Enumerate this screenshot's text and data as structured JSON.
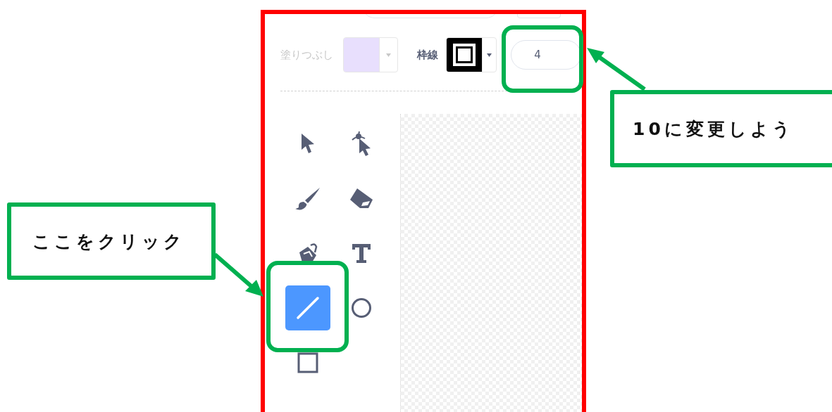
{
  "toolbar": {
    "fill": {
      "label": "塗りつぶし",
      "color": "#e0d4fc",
      "disabled": true
    },
    "outline": {
      "label": "枠線",
      "color": "#000000",
      "disabled": false
    },
    "width_field": {
      "value": "4"
    }
  },
  "tools": [
    {
      "kind": "select",
      "selected": false
    },
    {
      "kind": "reshape",
      "selected": false
    },
    {
      "kind": "brush",
      "selected": false
    },
    {
      "kind": "eraser",
      "selected": false
    },
    {
      "kind": "fill",
      "selected": false
    },
    {
      "kind": "text",
      "selected": false
    },
    {
      "kind": "line",
      "selected": true
    },
    {
      "kind": "circle",
      "selected": false
    },
    {
      "kind": "rect",
      "selected": false
    }
  ],
  "callouts": [
    {
      "text": "ここをクリック"
    },
    {
      "text": "10に変更しよう"
    }
  ]
}
